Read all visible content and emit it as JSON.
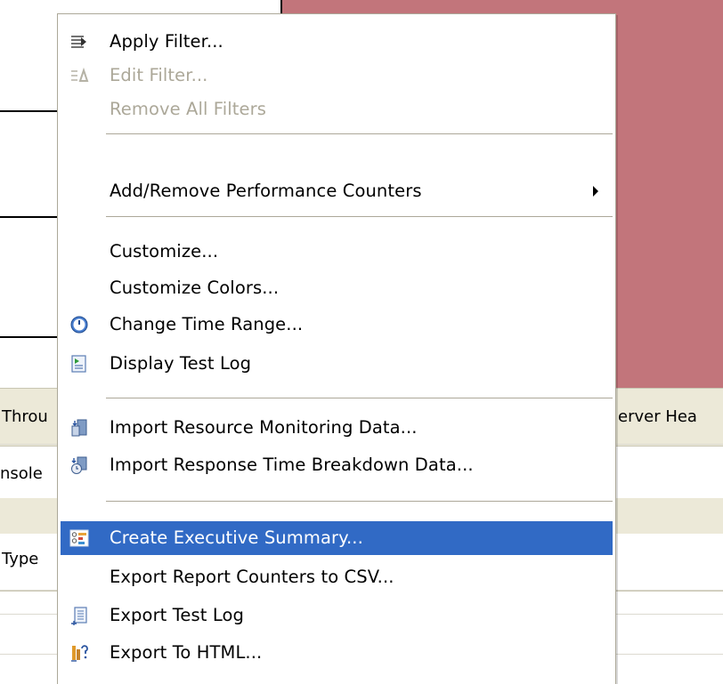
{
  "background": {
    "chart_color": "#c2757b",
    "tabs": [
      {
        "label": "Throu"
      },
      {
        "label": "erver Hea"
      }
    ],
    "rows": [
      {
        "label": "nsole"
      },
      {
        "label": "Type"
      }
    ]
  },
  "context_menu": {
    "items": [
      {
        "label": "Apply Filter...",
        "icon": "filter-icon",
        "enabled": true
      },
      {
        "label": "Edit Filter...",
        "icon": "edit-filter-icon",
        "enabled": false
      },
      {
        "label": "Remove All Filters",
        "icon": "",
        "enabled": false
      },
      {
        "label": "Add/Remove Performance Counters",
        "icon": "",
        "enabled": true,
        "submenu": true
      },
      {
        "label": "Customize...",
        "icon": "",
        "enabled": true
      },
      {
        "label": "Customize Colors...",
        "icon": "",
        "enabled": true
      },
      {
        "label": "Change Time Range...",
        "icon": "clock-icon",
        "enabled": true
      },
      {
        "label": "Display Test Log",
        "icon": "test-log-icon",
        "enabled": true
      },
      {
        "label": "Import Resource Monitoring Data...",
        "icon": "import-resource-icon",
        "enabled": true
      },
      {
        "label": "Import Response Time Breakdown Data...",
        "icon": "import-breakdown-icon",
        "enabled": true
      },
      {
        "label": "Create Executive Summary...",
        "icon": "executive-summary-icon",
        "enabled": true,
        "selected": true
      },
      {
        "label": "Export Report Counters to CSV...",
        "icon": "",
        "enabled": true
      },
      {
        "label": "Export Test Log",
        "icon": "export-log-icon",
        "enabled": true
      },
      {
        "label": "Export To HTML...",
        "icon": "export-html-icon",
        "enabled": true
      }
    ],
    "selection_color": "#316ac5"
  }
}
